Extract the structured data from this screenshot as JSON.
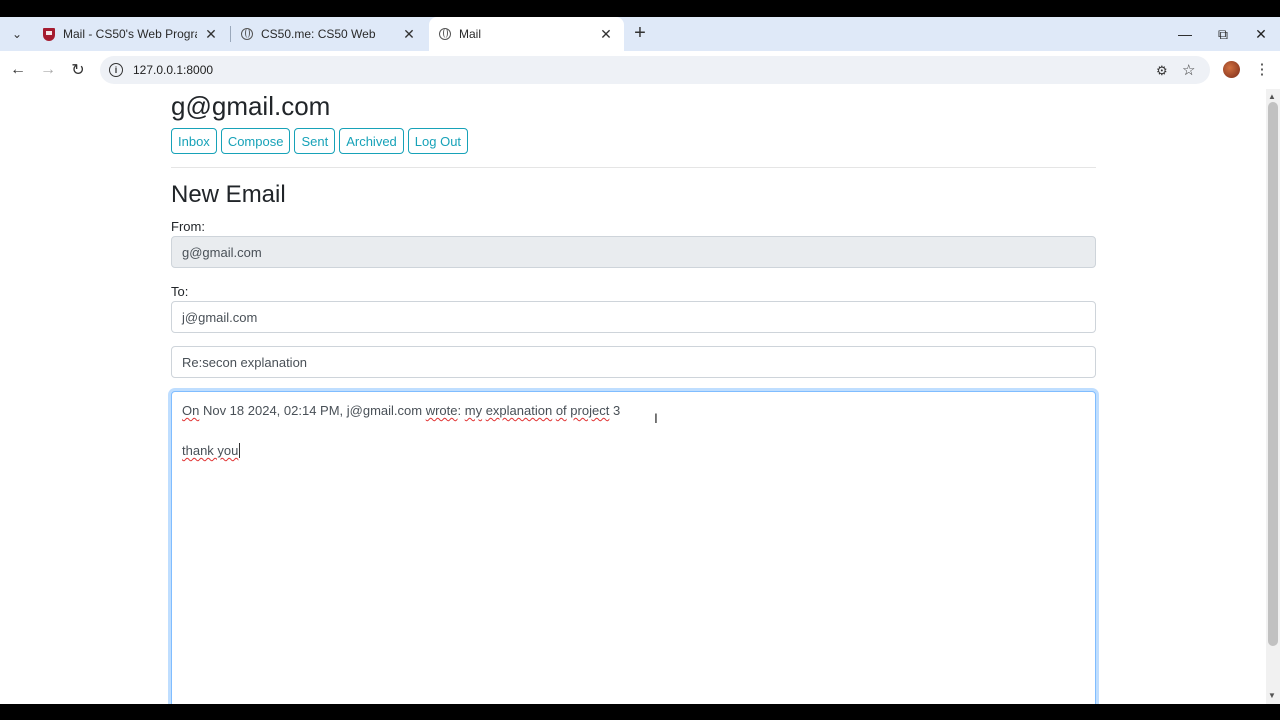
{
  "browser": {
    "tabs": [
      {
        "title": "Mail - CS50's Web Programmin",
        "favicon": "harvard-shield-icon",
        "active": false
      },
      {
        "title": "CS50.me: CS50 Web",
        "favicon": "globe-icon",
        "active": false
      },
      {
        "title": "Mail",
        "favicon": "globe-icon",
        "active": true
      }
    ],
    "url": "127.0.0.1:8000"
  },
  "header": {
    "user_email": "g@gmail.com",
    "nav": {
      "inbox": "Inbox",
      "compose": "Compose",
      "sent": "Sent",
      "archived": "Archived",
      "logout": "Log Out"
    }
  },
  "compose": {
    "heading": "New Email",
    "from_label": "From:",
    "from_value": "g@gmail.com",
    "to_label": "To:",
    "to_value": "j@gmail.com",
    "subject_value": "Re:secon explanation",
    "body": {
      "w1": "On",
      "w2": " Nov 18 2024, 02:14 PM, j@gmail.com ",
      "w3": "wrote",
      "w4": ": ",
      "w5": "my",
      "w6": " ",
      "w7": "explanation",
      "w8": " ",
      "w9": "of",
      "w10": " ",
      "w11": "project",
      "w12": " 3",
      "line2": "thank you"
    }
  },
  "colors": {
    "accent": "#17a2b8",
    "focus": "#80bdff"
  }
}
